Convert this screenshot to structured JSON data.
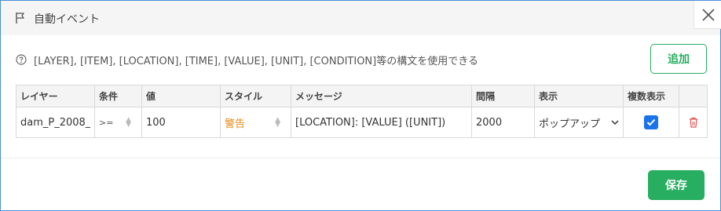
{
  "dialog": {
    "title": "自動イベント",
    "hint": "[LAYER], [ITEM], [LOCATION], [TIME], [VALUE], [UNIT], [CONDITION]等の構文を使用できる",
    "add_label": "追加",
    "save_label": "保存"
  },
  "table": {
    "headers": [
      "レイヤー",
      "条件",
      "値",
      "スタイル",
      "メッセージ",
      "間隔",
      "表示",
      "複数表示",
      ""
    ],
    "rows": [
      {
        "layer": "dam_P_2008_",
        "condition": ">=",
        "value": "100",
        "style": "警告",
        "message": "[LOCATION]: [VALUE] ([UNIT])",
        "interval": "2000",
        "display": "ポップアップ",
        "multi_display": true
      }
    ]
  },
  "colors": {
    "accent_green": "#27ae60",
    "checkbox_blue": "#1a73e8",
    "warning_orange": "#e88a1a",
    "delete_red": "#e05555"
  }
}
